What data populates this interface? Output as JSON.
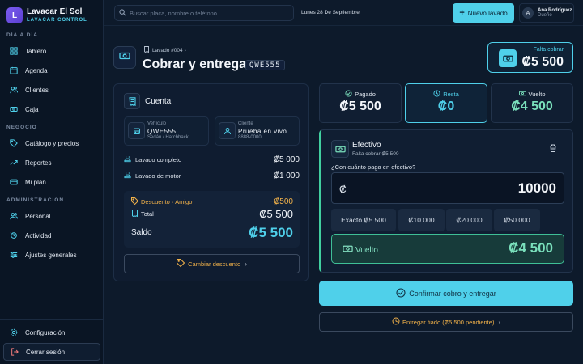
{
  "brand": {
    "initial": "L",
    "name": "Lavacar El Sol",
    "subtitle": "LAVACAR CONTROL"
  },
  "sidebar": {
    "sections": [
      {
        "label": "DÍA A DÍA"
      },
      {
        "label": "NEGOCIO"
      },
      {
        "label": "ADMINISTRACIÓN"
      }
    ],
    "items": [
      {
        "label": "Tablero",
        "icon": "grid-icon"
      },
      {
        "label": "Agenda",
        "icon": "calendar-icon"
      },
      {
        "label": "Clientes",
        "icon": "users-icon"
      },
      {
        "label": "Caja",
        "icon": "cash-icon"
      },
      {
        "label": "Catálogo y precios",
        "icon": "tag-icon"
      },
      {
        "label": "Reportes",
        "icon": "chart-icon"
      },
      {
        "label": "Mi plan",
        "icon": "card-icon"
      },
      {
        "label": "Personal",
        "icon": "users-icon"
      },
      {
        "label": "Actividad",
        "icon": "history-icon"
      },
      {
        "label": "Ajustes generales",
        "icon": "sliders-icon"
      }
    ],
    "footer": {
      "settings": "Configuración",
      "logout": "Cerrar sesión"
    }
  },
  "topbar": {
    "search_placeholder": "Buscar placa, nombre o teléfono...",
    "date": "Lunes 28 De Septiembre",
    "new_button": "Nuevo lavado",
    "user": {
      "initial": "A",
      "name": "Ana Rodríguez",
      "role": "Dueño"
    }
  },
  "header": {
    "breadcrumb": "Lavado #004",
    "title": "Cobrar y entregar",
    "plate": "QWE555",
    "due_label": "Falta cobrar",
    "due_amount": "₡5 500"
  },
  "account": {
    "title": "Cuenta",
    "vehicle": {
      "label": "Vehículo",
      "value": "QWE555",
      "sub": "Sedán / Hatchback"
    },
    "client": {
      "label": "Cliente",
      "value": "Prueba en vivo",
      "sub": "8888-0000"
    },
    "items": [
      {
        "name": "Lavado completo",
        "amount": "₡5 000"
      },
      {
        "name": "Lavado de motor",
        "amount": "₡1 000"
      }
    ],
    "discount_label": "Descuento · Amigo",
    "discount_amount": "−₡500",
    "total_label": "Total",
    "total_amount": "₡5 500",
    "balance_label": "Saldo",
    "balance_amount": "₡5 500",
    "change_discount": "Cambiar descuento"
  },
  "stats": {
    "paid": {
      "label": "Pagado",
      "value": "₡5 500"
    },
    "remaining": {
      "label": "Resta",
      "value": "₡0"
    },
    "change": {
      "label": "Vuelto",
      "value": "₡4 500"
    }
  },
  "payment": {
    "method": "Efectivo",
    "subtitle": "Falta cobrar ₡5 500",
    "question": "¿Con cuánto paga en efectivo?",
    "currency_symbol": "₡",
    "amount_value": "10000",
    "quick": [
      "Exacto ₡5 500",
      "₡10 000",
      "₡20 000",
      "₡50 000"
    ],
    "change_label": "Vuelto",
    "change_value": "₡4 500"
  },
  "actions": {
    "confirm": "Confirmar cobro y entregar",
    "credit": "Entregar fiado (₡5 500 pendiente)"
  },
  "colors": {
    "accent": "#4fd0ea",
    "success": "#41d0a0",
    "warning": "#f2b24a",
    "background": "#0d1a2b"
  }
}
